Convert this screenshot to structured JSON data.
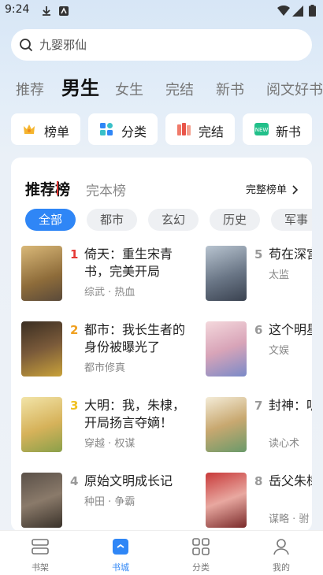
{
  "status_bar": {
    "time": "9:24"
  },
  "search": {
    "placeholder": "九婴邪仙"
  },
  "top_tabs": [
    "推荐",
    "男生",
    "女生",
    "完结",
    "新书",
    "阅文好书"
  ],
  "active_top_tab": "男生",
  "quick_entries": [
    {
      "label": "榜单",
      "icon": "crown-icon"
    },
    {
      "label": "分类",
      "icon": "grid-icon"
    },
    {
      "label": "完结",
      "icon": "books-icon"
    },
    {
      "label": "新书",
      "icon": "new-icon"
    }
  ],
  "rank": {
    "tabs": [
      "推荐榜",
      "完本榜"
    ],
    "more_label": "完整榜单",
    "chips": [
      "全部",
      "都市",
      "玄幻",
      "历史",
      "军事"
    ],
    "books": [
      {
        "num": "1",
        "title": "倚天：重生宋青书，完美开局",
        "meta": "综武 · 热血"
      },
      {
        "num": "2",
        "title": "都市：我长生者的身份被曝光了",
        "meta": "都市修真"
      },
      {
        "num": "3",
        "title": "大明：我，朱棣，开局扬言夺嫡！",
        "meta": "穿越 · 权谋"
      },
      {
        "num": "4",
        "title": "原始文明成长记",
        "meta": "种田 · 争霸"
      },
      {
        "num": "5",
        "title": "苟在深宫",
        "meta": "太监"
      },
      {
        "num": "6",
        "title": "这个明星",
        "meta": "文娱"
      },
      {
        "num": "7",
        "title": "封神：听心声",
        "meta": "读心术"
      },
      {
        "num": "8",
        "title": "岳父朱棣容郡主",
        "meta": "谋略 · 驸"
      }
    ]
  },
  "bottom_nav": [
    {
      "label": "书架",
      "icon": "bookshelf-icon"
    },
    {
      "label": "书城",
      "icon": "bookstore-icon"
    },
    {
      "label": "分类",
      "icon": "category-icon"
    },
    {
      "label": "我的",
      "icon": "profile-icon"
    }
  ],
  "colors": {
    "accent": "#2f86f6",
    "rank_top": "#e53935",
    "rank_mid": "#f0a020",
    "rank_low": "#999999"
  }
}
